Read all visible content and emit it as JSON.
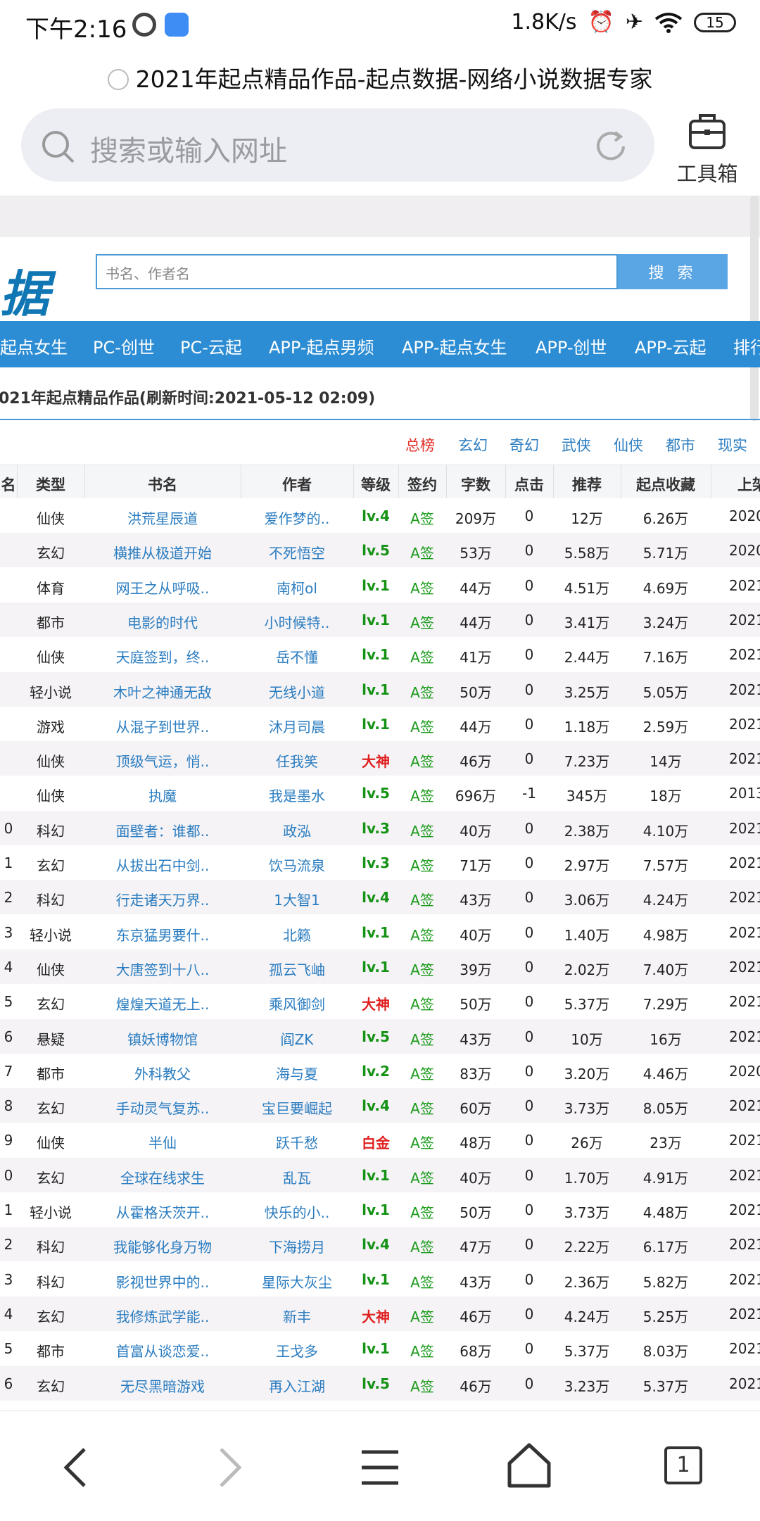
{
  "status": {
    "time": "下午2:16",
    "net_speed": "1.8K/s",
    "battery": "15"
  },
  "browser": {
    "page_title": "2021年起点精品作品-起点数据-网络小说数据专家",
    "url_placeholder": "搜索或输入网址",
    "toolbox_label": "工具箱"
  },
  "site": {
    "logo_text": "据",
    "search_placeholder": "书名、作者名",
    "search_button": "搜 索",
    "nav": [
      "起点女生",
      "PC-创世",
      "PC-云起",
      "APP-起点男频",
      "APP-起点女生",
      "APP-创世",
      "APP-云起",
      "排行"
    ],
    "section_title": "021年起点精品作品(刷新时间:2021-05-12 02:09)",
    "categories": [
      "总榜",
      "玄幻",
      "奇幻",
      "武侠",
      "仙侠",
      "都市",
      "现实"
    ],
    "active_category_color": "#e0302a",
    "link_color": "#2a7cc0",
    "nav_color": "#2d8dd4"
  },
  "table": {
    "headers": [
      "名",
      "类型",
      "书名",
      "作者",
      "等级",
      "签约",
      "字数",
      "点击",
      "推荐",
      "起点收藏",
      "上架"
    ],
    "rows": [
      {
        "rank": "",
        "type": "仙侠",
        "book": "洪荒星辰道",
        "author": "爱作梦的..",
        "level": "lv.4",
        "sign": "A签",
        "words": "209万",
        "clicks": "0",
        "rec": "12万",
        "fav": "6.26万",
        "date": "2020"
      },
      {
        "rank": "",
        "type": "玄幻",
        "book": "横推从极道开始",
        "author": "不死悟空",
        "level": "lv.5",
        "sign": "A签",
        "words": "53万",
        "clicks": "0",
        "rec": "5.58万",
        "fav": "5.71万",
        "date": "2020"
      },
      {
        "rank": "",
        "type": "体育",
        "book": "网王之从呼吸..",
        "author": "南柯ol",
        "level": "lv.1",
        "sign": "A签",
        "words": "44万",
        "clicks": "0",
        "rec": "4.51万",
        "fav": "4.69万",
        "date": "2021"
      },
      {
        "rank": "",
        "type": "都市",
        "book": "电影的时代",
        "author": "小时候特..",
        "level": "lv.1",
        "sign": "A签",
        "words": "44万",
        "clicks": "0",
        "rec": "3.41万",
        "fav": "3.24万",
        "date": "2021"
      },
      {
        "rank": "",
        "type": "仙侠",
        "book": "天庭签到，终..",
        "author": "岳不懂",
        "level": "lv.1",
        "sign": "A签",
        "words": "41万",
        "clicks": "0",
        "rec": "2.44万",
        "fav": "7.16万",
        "date": "2021"
      },
      {
        "rank": "",
        "type": "轻小说",
        "book": "木叶之神通无敌",
        "author": "无线小道",
        "level": "lv.1",
        "sign": "A签",
        "words": "50万",
        "clicks": "0",
        "rec": "3.25万",
        "fav": "5.05万",
        "date": "2021"
      },
      {
        "rank": "",
        "type": "游戏",
        "book": "从混子到世界..",
        "author": "沐月司晨",
        "level": "lv.1",
        "sign": "A签",
        "words": "44万",
        "clicks": "0",
        "rec": "1.18万",
        "fav": "2.59万",
        "date": "2021"
      },
      {
        "rank": "",
        "type": "仙侠",
        "book": "顶级气运，悄..",
        "author": "任我笑",
        "level": "大神",
        "sign": "A签",
        "words": "46万",
        "clicks": "0",
        "rec": "7.23万",
        "fav": "14万",
        "date": "2021"
      },
      {
        "rank": "",
        "type": "仙侠",
        "book": "执魔",
        "author": "我是墨水",
        "level": "lv.5",
        "sign": "A签",
        "words": "696万",
        "clicks": "-1",
        "rec": "345万",
        "fav": "18万",
        "date": "2013"
      },
      {
        "rank": "0",
        "type": "科幻",
        "book": "面壁者：谁都..",
        "author": "政泓",
        "level": "lv.3",
        "sign": "A签",
        "words": "40万",
        "clicks": "0",
        "rec": "2.38万",
        "fav": "4.10万",
        "date": "2021"
      },
      {
        "rank": "1",
        "type": "玄幻",
        "book": "从拔出石中剑..",
        "author": "饮马流泉",
        "level": "lv.3",
        "sign": "A签",
        "words": "71万",
        "clicks": "0",
        "rec": "2.97万",
        "fav": "7.57万",
        "date": "2021"
      },
      {
        "rank": "2",
        "type": "科幻",
        "book": "行走诸天万界..",
        "author": "1大智1",
        "level": "lv.4",
        "sign": "A签",
        "words": "43万",
        "clicks": "0",
        "rec": "3.06万",
        "fav": "4.24万",
        "date": "2021"
      },
      {
        "rank": "3",
        "type": "轻小说",
        "book": "东京猛男要什..",
        "author": "北籁",
        "level": "lv.1",
        "sign": "A签",
        "words": "40万",
        "clicks": "0",
        "rec": "1.40万",
        "fav": "4.98万",
        "date": "2021"
      },
      {
        "rank": "4",
        "type": "仙侠",
        "book": "大唐签到十八..",
        "author": "孤云飞岫",
        "level": "lv.1",
        "sign": "A签",
        "words": "39万",
        "clicks": "0",
        "rec": "2.02万",
        "fav": "7.40万",
        "date": "2021"
      },
      {
        "rank": "5",
        "type": "玄幻",
        "book": "煌煌天道无上..",
        "author": "乘风御剑",
        "level": "大神",
        "sign": "A签",
        "words": "50万",
        "clicks": "0",
        "rec": "5.37万",
        "fav": "7.29万",
        "date": "2021"
      },
      {
        "rank": "6",
        "type": "悬疑",
        "book": "镇妖博物馆",
        "author": "阎ZK",
        "level": "lv.5",
        "sign": "A签",
        "words": "43万",
        "clicks": "0",
        "rec": "10万",
        "fav": "16万",
        "date": "2021"
      },
      {
        "rank": "7",
        "type": "都市",
        "book": "外科教父",
        "author": "海与夏",
        "level": "lv.2",
        "sign": "A签",
        "words": "83万",
        "clicks": "0",
        "rec": "3.20万",
        "fav": "4.46万",
        "date": "2020"
      },
      {
        "rank": "8",
        "type": "玄幻",
        "book": "手动灵气复苏..",
        "author": "宝巨要崛起",
        "level": "lv.4",
        "sign": "A签",
        "words": "60万",
        "clicks": "0",
        "rec": "3.73万",
        "fav": "8.05万",
        "date": "2021"
      },
      {
        "rank": "9",
        "type": "仙侠",
        "book": "半仙",
        "author": "跃千愁",
        "level": "白金",
        "sign": "A签",
        "words": "48万",
        "clicks": "0",
        "rec": "26万",
        "fav": "23万",
        "date": "2021"
      },
      {
        "rank": "0",
        "type": "玄幻",
        "book": "全球在线求生",
        "author": "乱瓦",
        "level": "lv.1",
        "sign": "A签",
        "words": "40万",
        "clicks": "0",
        "rec": "1.70万",
        "fav": "4.91万",
        "date": "2021"
      },
      {
        "rank": "1",
        "type": "轻小说",
        "book": "从霍格沃茨开..",
        "author": "快乐的小..",
        "level": "lv.1",
        "sign": "A签",
        "words": "50万",
        "clicks": "0",
        "rec": "3.73万",
        "fav": "4.48万",
        "date": "2021"
      },
      {
        "rank": "2",
        "type": "科幻",
        "book": "我能够化身万物",
        "author": "下海捞月",
        "level": "lv.4",
        "sign": "A签",
        "words": "47万",
        "clicks": "0",
        "rec": "2.22万",
        "fav": "6.17万",
        "date": "2021"
      },
      {
        "rank": "3",
        "type": "科幻",
        "book": "影视世界中的..",
        "author": "星际大灰尘",
        "level": "lv.1",
        "sign": "A签",
        "words": "43万",
        "clicks": "0",
        "rec": "2.36万",
        "fav": "5.82万",
        "date": "2021"
      },
      {
        "rank": "4",
        "type": "玄幻",
        "book": "我修炼武学能..",
        "author": "新丰",
        "level": "大神",
        "sign": "A签",
        "words": "46万",
        "clicks": "0",
        "rec": "4.24万",
        "fav": "5.25万",
        "date": "2021"
      },
      {
        "rank": "5",
        "type": "都市",
        "book": "首富从谈恋爱..",
        "author": "王戈多",
        "level": "lv.1",
        "sign": "A签",
        "words": "68万",
        "clicks": "0",
        "rec": "5.37万",
        "fav": "8.03万",
        "date": "2021"
      },
      {
        "rank": "6",
        "type": "玄幻",
        "book": "无尽黑暗游戏",
        "author": "再入江湖",
        "level": "lv.5",
        "sign": "A签",
        "words": "46万",
        "clicks": "0",
        "rec": "3.23万",
        "fav": "5.37万",
        "date": "2021"
      }
    ]
  },
  "bottom_nav": {
    "tab_count": "1"
  }
}
